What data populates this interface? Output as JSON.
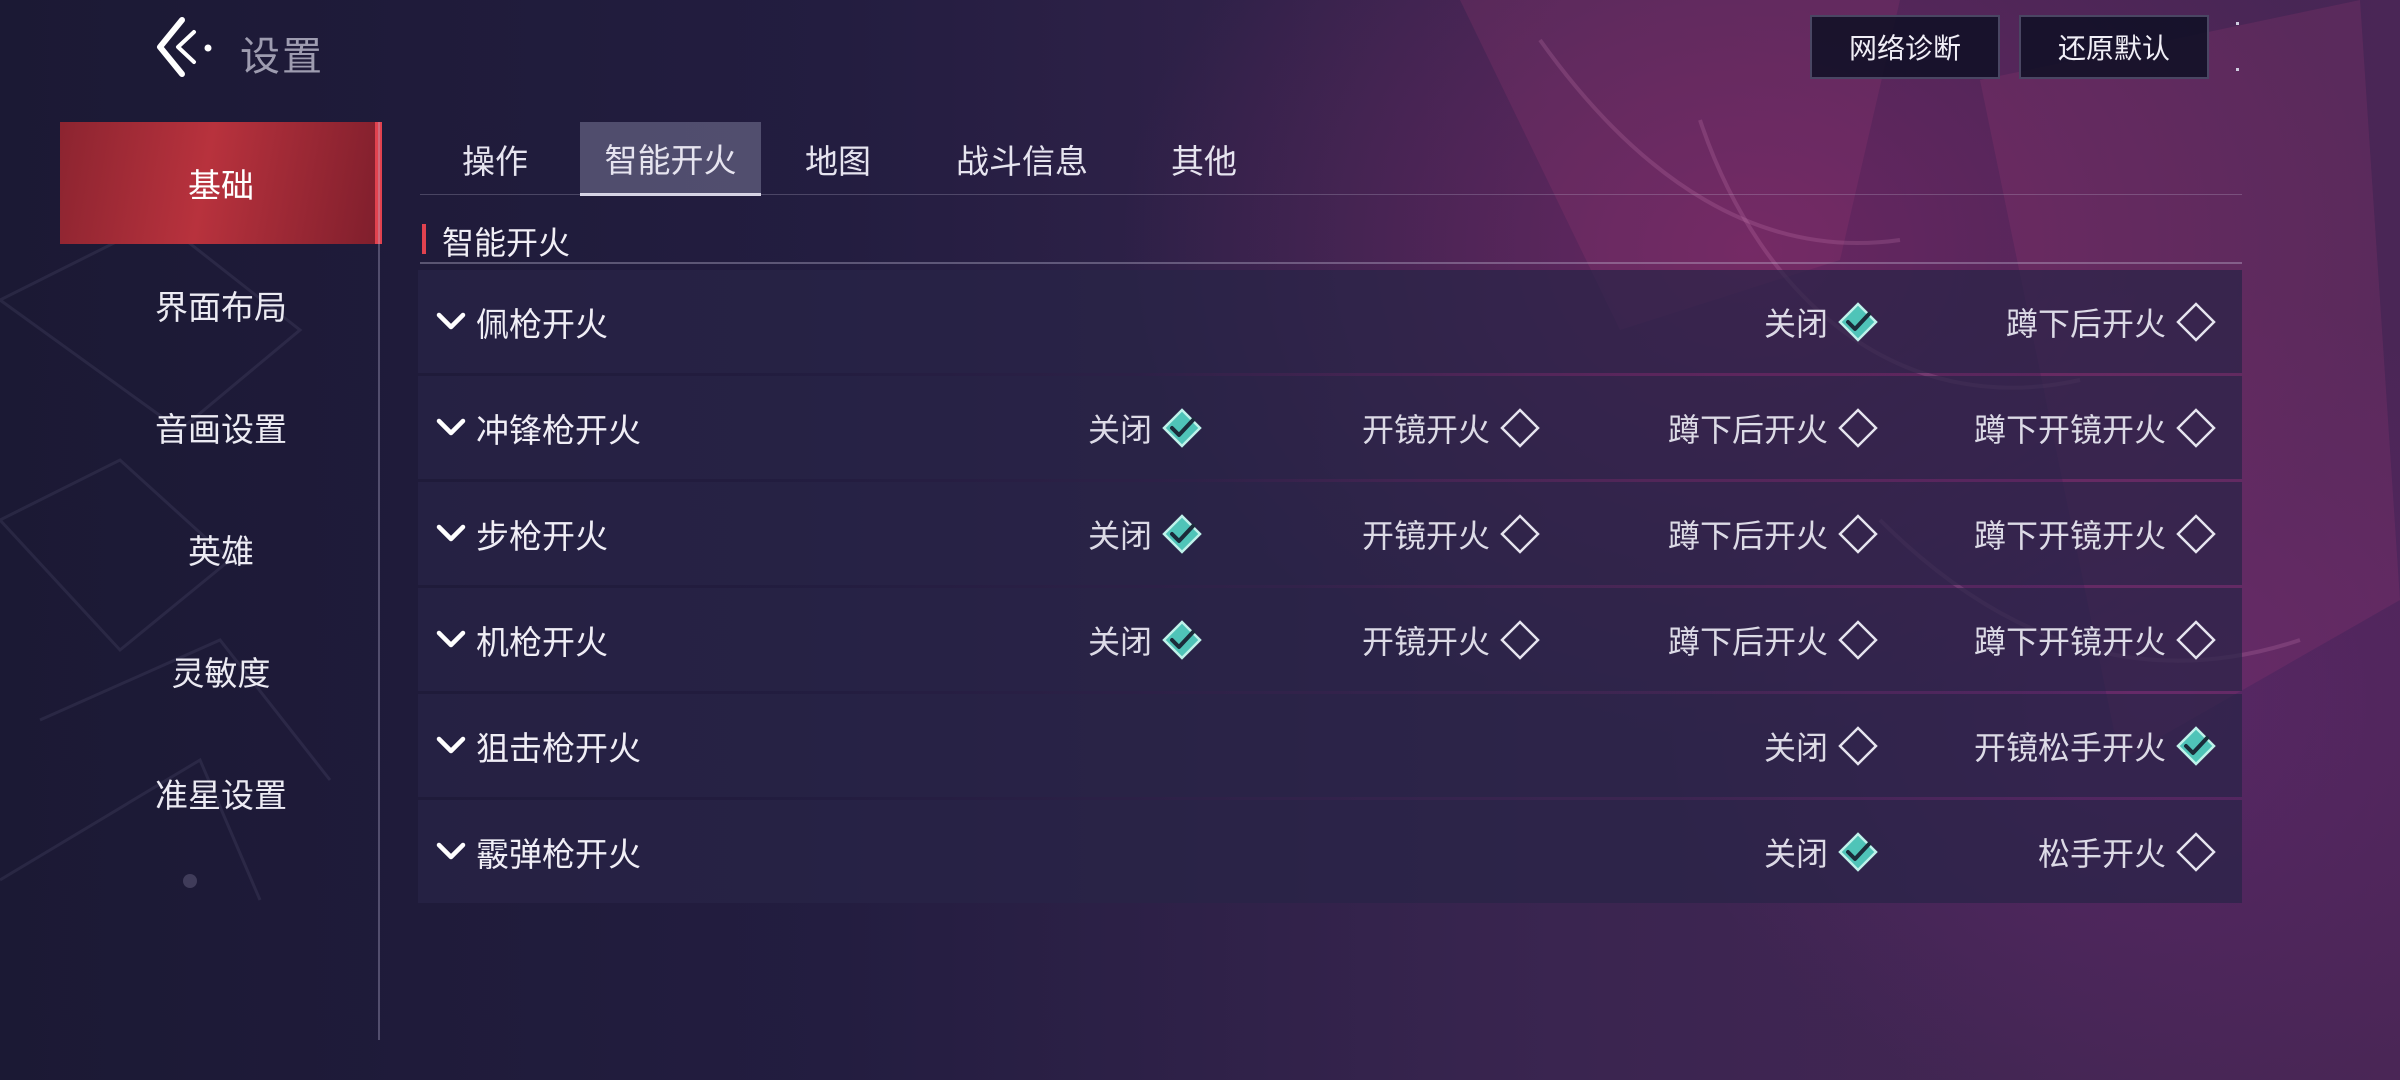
{
  "header": {
    "title": "设置",
    "network_diag_label": "网络诊断",
    "reset_default_label": "还原默认"
  },
  "sidebar": {
    "items": [
      {
        "label": "基础",
        "active": true
      },
      {
        "label": "界面布局",
        "active": false
      },
      {
        "label": "音画设置",
        "active": false
      },
      {
        "label": "英雄",
        "active": false
      },
      {
        "label": "灵敏度",
        "active": false
      },
      {
        "label": "准星设置",
        "active": false
      }
    ]
  },
  "tabs": [
    {
      "label": "操作",
      "active": false
    },
    {
      "label": "智能开火",
      "active": true
    },
    {
      "label": "地图",
      "active": false
    },
    {
      "label": "战斗信息",
      "active": false
    },
    {
      "label": "其他",
      "active": false
    }
  ],
  "section": {
    "title": "智能开火"
  },
  "rows": [
    {
      "label": "佩枪开火",
      "options": [
        {
          "label": "关闭",
          "selected": true
        },
        {
          "label": "蹲下后开火",
          "selected": false
        }
      ]
    },
    {
      "label": "冲锋枪开火",
      "options": [
        {
          "label": "关闭",
          "selected": true
        },
        {
          "label": "开镜开火",
          "selected": false
        },
        {
          "label": "蹲下后开火",
          "selected": false
        },
        {
          "label": "蹲下开镜开火",
          "selected": false
        }
      ]
    },
    {
      "label": "步枪开火",
      "options": [
        {
          "label": "关闭",
          "selected": true
        },
        {
          "label": "开镜开火",
          "selected": false
        },
        {
          "label": "蹲下后开火",
          "selected": false
        },
        {
          "label": "蹲下开镜开火",
          "selected": false
        }
      ]
    },
    {
      "label": "机枪开火",
      "options": [
        {
          "label": "关闭",
          "selected": true
        },
        {
          "label": "开镜开火",
          "selected": false
        },
        {
          "label": "蹲下后开火",
          "selected": false
        },
        {
          "label": "蹲下开镜开火",
          "selected": false
        }
      ]
    },
    {
      "label": "狙击枪开火",
      "options": [
        {
          "label": "关闭",
          "selected": false
        },
        {
          "label": "开镜松手开火",
          "selected": true
        }
      ]
    },
    {
      "label": "霰弹枪开火",
      "options": [
        {
          "label": "关闭",
          "selected": true
        },
        {
          "label": "松手开火",
          "selected": false
        }
      ]
    }
  ],
  "icons": {
    "back": "back-arrow-icon",
    "expand": "chevron-down-icon",
    "radio_on": "diamond-checked-icon",
    "radio_off": "diamond-unchecked-icon"
  },
  "colors": {
    "accent_red": "#e0424f",
    "selected_teal": "#4fc4b8"
  }
}
